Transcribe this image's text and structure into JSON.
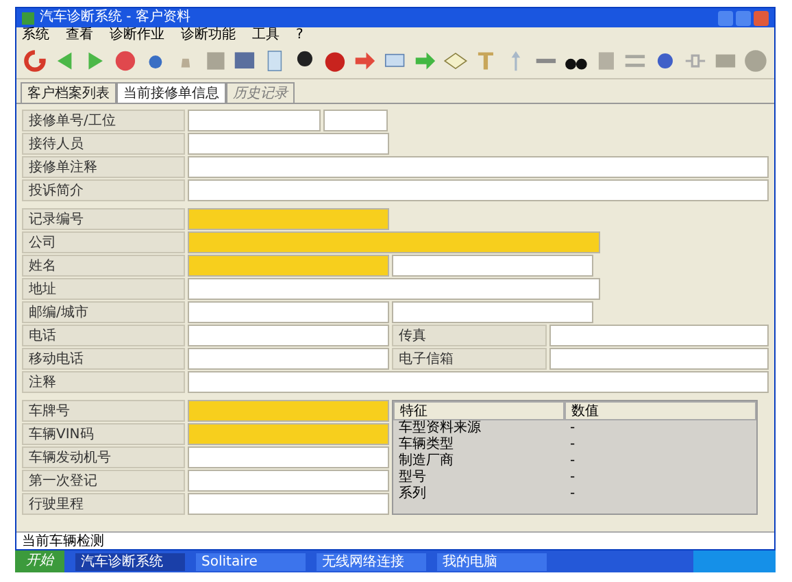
{
  "window": {
    "title": "汽车诊断系统 - 客户资料"
  },
  "menu": [
    "系统",
    "查看",
    "诊断作业",
    "诊断功能",
    "工具",
    "?"
  ],
  "tabs": [
    {
      "label": "客户档案列表",
      "selected": false,
      "disabled": false
    },
    {
      "label": "当前接修单信息",
      "selected": true,
      "disabled": false
    },
    {
      "label": "历史记录",
      "selected": false,
      "disabled": true
    }
  ],
  "sections": [
    {
      "rows": [
        {
          "items": [
            {
              "kind": "label",
              "text": "接修单号/工位"
            },
            {
              "kind": "part",
              "required": false
            },
            {
              "kind": "short",
              "required": false
            }
          ]
        },
        {
          "items": [
            {
              "kind": "label",
              "text": "接待人员"
            },
            {
              "kind": "half",
              "required": false
            }
          ]
        },
        {
          "items": [
            {
              "kind": "label",
              "text": "接修单注释"
            },
            {
              "kind": "full",
              "required": false
            }
          ]
        },
        {
          "items": [
            {
              "kind": "label",
              "text": "投诉简介"
            },
            {
              "kind": "full",
              "required": false
            }
          ]
        }
      ]
    },
    {
      "rows": [
        {
          "items": [
            {
              "kind": "label",
              "text": "记录编号"
            },
            {
              "kind": "half",
              "required": true
            }
          ]
        },
        {
          "items": [
            {
              "kind": "label",
              "text": "公司"
            },
            {
              "kind": "wide",
              "required": true
            }
          ]
        },
        {
          "items": [
            {
              "kind": "label",
              "text": "姓名"
            },
            {
              "kind": "half",
              "required": true
            },
            {
              "kind": "half",
              "required": false
            }
          ]
        },
        {
          "items": [
            {
              "kind": "label",
              "text": "地址"
            },
            {
              "kind": "wide",
              "required": false
            }
          ]
        },
        {
          "items": [
            {
              "kind": "label",
              "text": "邮编/城市"
            },
            {
              "kind": "half",
              "required": false
            },
            {
              "kind": "half",
              "required": false
            }
          ]
        },
        {
          "items": [
            {
              "kind": "label",
              "text": "电话"
            },
            {
              "kind": "half",
              "required": false
            },
            {
              "kind": "label",
              "text": "传真"
            },
            {
              "kind": "full",
              "required": false
            }
          ]
        },
        {
          "items": [
            {
              "kind": "label",
              "text": "移动电话"
            },
            {
              "kind": "half",
              "required": false
            },
            {
              "kind": "label",
              "text": "电子信箱"
            },
            {
              "kind": "full",
              "required": false
            }
          ]
        },
        {
          "items": [
            {
              "kind": "label",
              "text": "注释"
            },
            {
              "kind": "full",
              "required": false
            }
          ]
        }
      ]
    }
  ],
  "vehicle": {
    "rows": [
      {
        "label": "车牌号",
        "required": true
      },
      {
        "label": "车辆VIN码",
        "required": true
      },
      {
        "label": "车辆发动机号",
        "required": false
      },
      {
        "label": "第一次登记",
        "required": false
      },
      {
        "label": "行驶里程",
        "required": false
      }
    ],
    "table": {
      "columns": [
        "特征",
        "数值"
      ],
      "rows": [
        [
          "车型资料来源",
          "-"
        ],
        [
          "车辆类型",
          "-"
        ],
        [
          "制造厂商",
          "-"
        ],
        [
          "型号",
          "-"
        ],
        [
          "系列",
          "-"
        ]
      ]
    }
  },
  "status_bar": "当前车辆检测",
  "taskbar": {
    "start": "开始",
    "tasks": [
      {
        "label": "汽车诊断系统",
        "selected": true
      },
      {
        "label": "Solitaire",
        "selected": false
      },
      {
        "label": "无线网络连接",
        "selected": false
      },
      {
        "label": "我的电脑",
        "selected": false
      }
    ]
  }
}
